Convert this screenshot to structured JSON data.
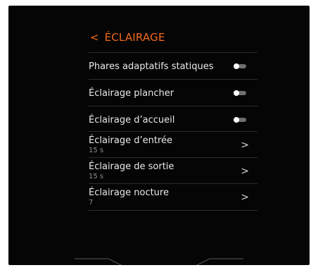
{
  "header": {
    "title": "ÉCLAIRAGE",
    "back_icon": "chevron-left-icon"
  },
  "accent": "#f26a1b",
  "settings": [
    {
      "label": "Phares adaptatifs statiques",
      "type": "toggle",
      "state": "off"
    },
    {
      "label": "Éclairage plancher",
      "type": "toggle",
      "state": "off"
    },
    {
      "label": "Éclairage d’accueil",
      "type": "toggle",
      "state": "off"
    },
    {
      "label": "Éclairage d’entrée",
      "value": "15 s",
      "type": "nav"
    },
    {
      "label": "Éclairage de sortie",
      "value": "15 s",
      "type": "nav"
    },
    {
      "label": "Éclairage nocture",
      "value": "7",
      "type": "nav"
    }
  ]
}
